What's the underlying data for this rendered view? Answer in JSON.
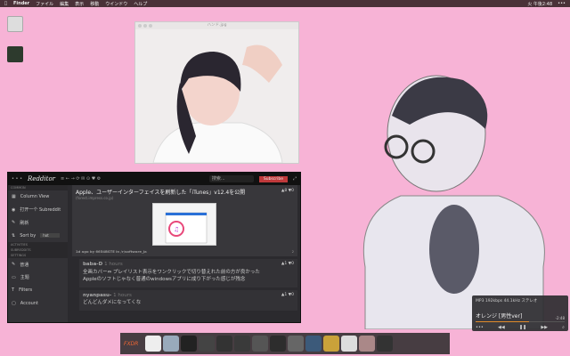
{
  "menubar": {
    "app": "Finder",
    "items": [
      "ファイル",
      "編集",
      "表示",
      "移動",
      "ウインドウ",
      "ヘルプ"
    ],
    "clock": "火 午後2:48",
    "more": "•••"
  },
  "preview": {
    "title": "ハンド.jpg"
  },
  "reddit": {
    "logo": "Redditor",
    "search_placeholder": "搜索...",
    "subscribe": "Subscribe",
    "sidebar": {
      "common": "COMMON",
      "items": [
        "Column View",
        "打开一个 Subreddit",
        "刷新"
      ],
      "sort_label": "Sort by",
      "sort_value": "hot",
      "activities": "ACTIVITIES",
      "subreddits": "SUBREDDITS",
      "settings": "SETTINGS",
      "settings_items": [
        "普通",
        "主题",
        "Filters",
        "Account"
      ]
    },
    "post": {
      "title": "Apple、ユーザーインターフェイスを刷新した「iTunes」v12.4を公開",
      "source": "(forest.impress.co.jp)",
      "up": "8",
      "down": "0",
      "meta": "1d ago by 6654BSTE in /r/software_ja",
      "comments": "2"
    },
    "comments": [
      {
        "user": "baba-D",
        "age": "1 hours",
        "up": "1",
        "down": "0",
        "lines": [
          "全画カバー⇔ プレイリスト表示をワンクリックで切り替えれた前の方が良かった",
          "Appleのソフトじゃなく普通のwindowsアプリに成り下がった感じが残念"
        ]
      },
      {
        "user": "nyanpasu-",
        "age": "1 hours",
        "up": "1",
        "down": "0",
        "lines": [
          "どんどんダメになってくな"
        ]
      }
    ]
  },
  "player": {
    "info": "MP3   192kbps   44.1kHz   ステレオ",
    "track": "オレンジ [男性ver]",
    "time": "-2:48",
    "progress": 0.6
  },
  "dock": {
    "label": "FXDR"
  }
}
